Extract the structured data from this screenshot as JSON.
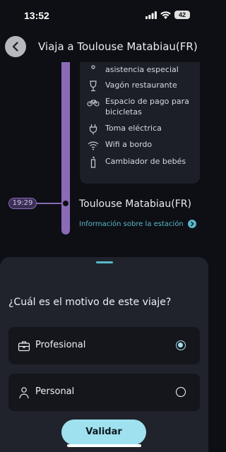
{
  "status_bar": {
    "time": "13:52",
    "battery": "42"
  },
  "header": {
    "title": "Viaja a Toulouse Matabiau(FR)"
  },
  "amenities": [
    {
      "icon": "accessibility-icon",
      "label": "asistencia especial"
    },
    {
      "icon": "wine-glass-icon",
      "label": "Vagón restaurante"
    },
    {
      "icon": "bicycle-icon",
      "label": "Espacio de pago para bicicletas"
    },
    {
      "icon": "power-plug-icon",
      "label": "Toma eléctrica"
    },
    {
      "icon": "wifi-icon",
      "label": "Wifi a bordo"
    },
    {
      "icon": "baby-bottle-icon",
      "label": "Cambiador de bebés"
    }
  ],
  "stop": {
    "time": "19:29",
    "station": "Toulouse Matabiau(FR)",
    "info_link": "Información sobre la estación"
  },
  "sheet": {
    "question": "¿Cuál es el motivo de este viaje?",
    "options": [
      {
        "label": "Profesional",
        "icon": "briefcase-icon",
        "selected": true
      },
      {
        "label": "Personal",
        "icon": "person-icon",
        "selected": false
      }
    ],
    "submit_label": "Validar"
  },
  "colors": {
    "accent": "#59b8c9",
    "timeline": "#8b6bb8",
    "button": "#9fe1ef",
    "background": "#0d0f14"
  }
}
